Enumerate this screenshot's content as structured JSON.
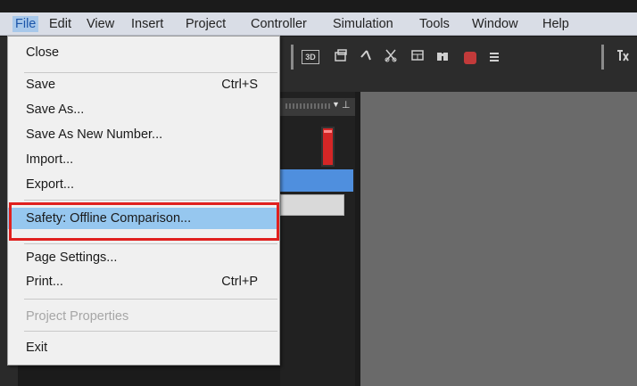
{
  "menubar": {
    "items": [
      {
        "label": "File",
        "active": true
      },
      {
        "label": "Edit"
      },
      {
        "label": "View"
      },
      {
        "label": "Insert"
      },
      {
        "label": "Project"
      },
      {
        "label": "Controller"
      },
      {
        "label": "Simulation"
      },
      {
        "label": "Tools"
      },
      {
        "label": "Window"
      },
      {
        "label": "Help"
      }
    ]
  },
  "toolbar": {
    "icons": [
      "3d-view-icon",
      "window-icon",
      "line-tool-icon",
      "cut-icon",
      "layout-icon",
      "binoculars-icon",
      "alert-icon",
      "small-doc-icon",
      "toolbar-overflow-icon"
    ],
    "labels": {
      "threed": "3D"
    }
  },
  "file_menu": {
    "close": "Close",
    "save": "Save",
    "save_shortcut": "Ctrl+S",
    "save_as": "Save As...",
    "save_as_new_number": "Save As New Number...",
    "import": "Import...",
    "export": "Export...",
    "safety_offline_comparison": "Safety: Offline Comparison...",
    "page_settings": "Page Settings...",
    "print": "Print...",
    "print_shortcut": "Ctrl+P",
    "project_properties": "Project Properties",
    "exit": "Exit"
  },
  "colors": {
    "highlight": "#96c7ef",
    "callout": "#e0201e",
    "menu_active": "#a8c8ea"
  }
}
